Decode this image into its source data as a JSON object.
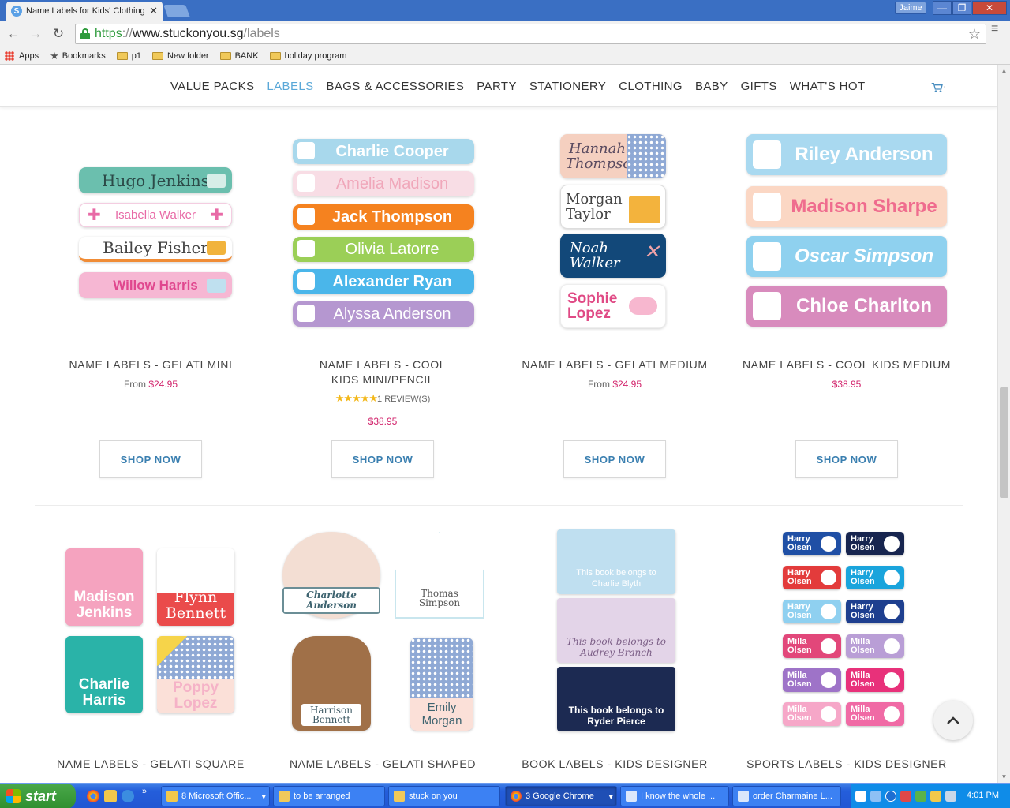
{
  "browser": {
    "tab_title": "Name Labels for Kids' Clothing",
    "tab_close": "✕",
    "user": "Jaime",
    "win_min": "—",
    "win_max": "❐",
    "win_close": "✕",
    "url_scheme": "https",
    "url_sep": "://",
    "url_host": "www.stuckonyou.sg",
    "url_path": "/labels",
    "back": "←",
    "forward": "→",
    "reload": "↻",
    "star": "☆",
    "bookmarks": [
      "Apps",
      "Bookmarks",
      "p1",
      "New folder",
      "BANK",
      "holiday program"
    ]
  },
  "nav": {
    "items": [
      "VALUE PACKS",
      "LABELS",
      "BAGS & ACCESSORIES",
      "PARTY",
      "STATIONERY",
      "CLOTHING",
      "BABY",
      "GIFTS",
      "WHAT'S HOT"
    ],
    "active": "LABELS"
  },
  "products_row1": [
    {
      "title": "NAME LABELS - GELATI MINI",
      "from": "From",
      "price": "$24.95",
      "button": "SHOP NOW"
    },
    {
      "title": "NAME LABELS - COOL KIDS MINI/PENCIL",
      "stars": "★★★★★",
      "reviews": "1 REVIEW(S)",
      "price": "$38.95",
      "button": "SHOP NOW"
    },
    {
      "title": "NAME LABELS - GELATI MEDIUM",
      "from": "From",
      "price": "$24.95",
      "button": "SHOP NOW"
    },
    {
      "title": "NAME LABELS - COOL KIDS MEDIUM",
      "price": "$38.95",
      "button": "SHOP NOW"
    }
  ],
  "products_row2": [
    {
      "title": "NAME LABELS - GELATI SQUARE"
    },
    {
      "title": "NAME LABELS - GELATI SHAPED"
    },
    {
      "title": "BOOK LABELS - KIDS DESIGNER"
    },
    {
      "title": "SPORTS LABELS - KIDS DESIGNER"
    }
  ],
  "art": {
    "gelati_mini": [
      "Hugo Jenkins",
      "Isabella Walker",
      "Bailey Fisher",
      "Willow Harris"
    ],
    "cool_kids_mini": [
      "Charlie Cooper",
      "Amelia Madison",
      "Jack Thompson",
      "Olivia Latorre",
      "Alexander Ryan",
      "Alyssa Anderson"
    ],
    "gelati_medium": [
      "Hannah Thompson",
      "Morgan Taylor",
      "Noah Walker",
      "Sophie Lopez"
    ],
    "cool_kids_medium": [
      "Riley Anderson",
      "Madison Sharpe",
      "Oscar Simpson",
      "Chloe Charlton"
    ],
    "gelati_square": [
      "Madison Jenkins",
      "Flynn Bennett",
      "Charlie Harris",
      "Poppy Lopez"
    ],
    "gelati_shaped": [
      "Charlotte Anderson",
      "Thomas Simpson",
      "Harrison Bennett",
      "Emily Morgan"
    ],
    "book": [
      {
        "line1": "This book belongs to",
        "line2": "Charlie Blyth"
      },
      {
        "line1": "This book belongs to",
        "line2": "Audrey Branch"
      },
      {
        "line1": "This book belongs to",
        "line2": "Ryder Pierce"
      }
    ],
    "sports": [
      {
        "first": "Harry",
        "last": "Olsen"
      },
      {
        "first": "Milla",
        "last": "Olsen"
      }
    ]
  },
  "taskbar": {
    "start": "start",
    "tasks": [
      "8 Microsoft Offic...",
      "to be arranged",
      "stuck on you",
      "3 Google Chrome",
      "I know the whole ...",
      "order Charmaine L..."
    ],
    "clock": "4:01 PM"
  },
  "colors": {
    "accent": "#5aa8d8",
    "price": "#d2246c",
    "button_text": "#3a7fb0"
  }
}
